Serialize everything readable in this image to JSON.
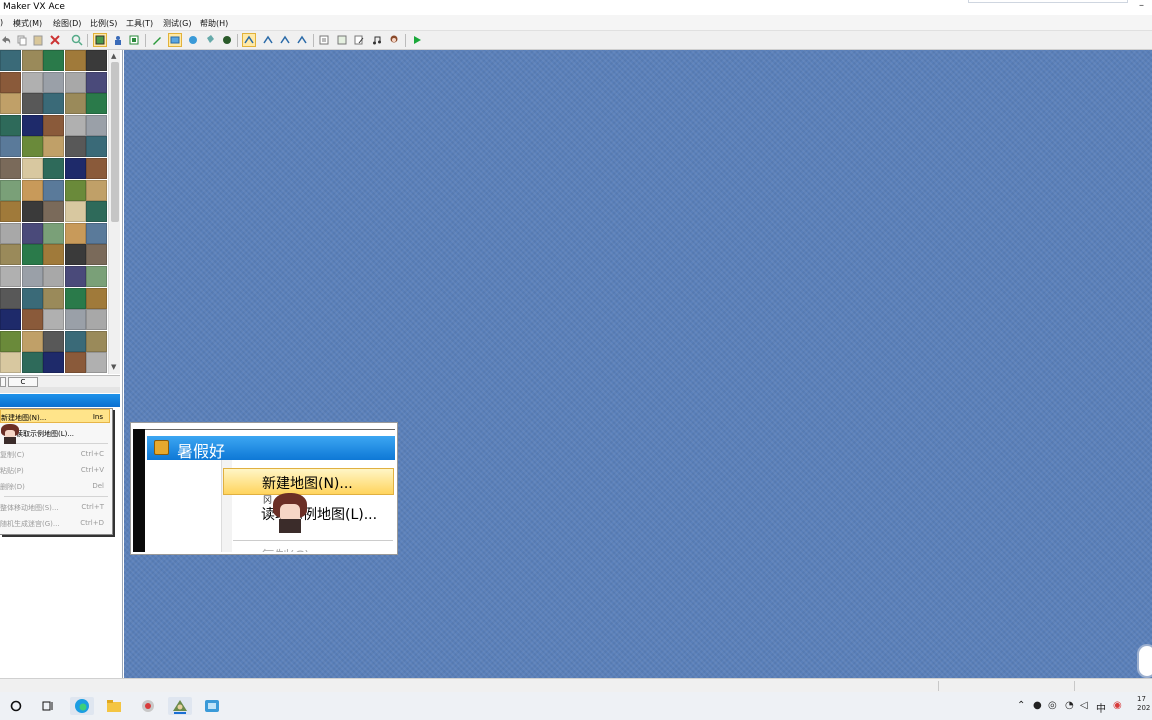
{
  "window": {
    "title": "Maker VX Ace",
    "minimize_glyph": "–"
  },
  "menubar": [
    {
      "id": "edit",
      "label": ")"
    },
    {
      "id": "mode",
      "label": "模式(M)"
    },
    {
      "id": "draw",
      "label": "绘图(D)"
    },
    {
      "id": "scale",
      "label": "比例(S)"
    },
    {
      "id": "tools",
      "label": "工具(T)"
    },
    {
      "id": "test",
      "label": "测试(G)"
    },
    {
      "id": "help",
      "label": "帮助(H)"
    }
  ],
  "toolbar": {
    "icons": [
      "undo-icon",
      "copy-icon",
      "paste-icon",
      "delete-icon",
      "search-icon",
      "layer-map-icon",
      "layer-event-icon",
      "pass-icon",
      "pencil-icon",
      "rectangle-icon",
      "ellipse-icon",
      "flood-fill-icon",
      "shadow-pen-icon",
      "zoom-1-1-icon",
      "zoom-1-2-icon",
      "zoom-1-4-icon",
      "zoom-1-8-icon",
      "database-icon",
      "resource-manager-icon",
      "script-editor-icon",
      "sound-test-icon",
      "character-generator-icon",
      "playtest-icon"
    ],
    "colors": {
      "accent_play": "#1aa83a",
      "selected": "#ffe9a6"
    }
  },
  "tileset_tabs": [
    "",
    "C"
  ],
  "context_menu": {
    "items": [
      {
        "label": "新建地图(N)...",
        "shortcut": "Ins",
        "highlighted": true,
        "disabled": false
      },
      {
        "label": "读取示例地图(L)...",
        "shortcut": "",
        "highlighted": false,
        "disabled": false
      },
      {
        "label": "复制(C)",
        "shortcut": "Ctrl+C",
        "highlighted": false,
        "disabled": true
      },
      {
        "label": "粘贴(P)",
        "shortcut": "Ctrl+V",
        "highlighted": false,
        "disabled": true
      },
      {
        "label": "删除(D)",
        "shortcut": "Del",
        "highlighted": false,
        "disabled": true
      },
      {
        "label": "整体移动地图(S)...",
        "shortcut": "Ctrl+T",
        "highlighted": false,
        "disabled": true
      },
      {
        "label": "随机生成迷宫(G)...",
        "shortcut": "Ctrl+D",
        "highlighted": false,
        "disabled": true
      }
    ]
  },
  "zoom_overlay": {
    "project_name": "暑假好",
    "items": [
      {
        "label": "新建地图(N)...",
        "highlighted": true
      },
      {
        "label": "读取示例地图(L)...",
        "highlighted": false
      },
      {
        "label": "复制(C)",
        "highlighted": false,
        "disabled": true
      }
    ],
    "small_glyph": "冈"
  },
  "taskbar": {
    "apps": [
      "search-icon",
      "task-view-icon",
      "edge-icon",
      "file-explorer-icon",
      "app-red-icon",
      "rpg-maker-icon",
      "app-blue-icon"
    ],
    "tray": [
      "chevron-up-icon",
      "microphone-icon",
      "network-icon",
      "wifi-icon",
      "speaker-icon",
      "ime-icon",
      "app-tray-icon"
    ],
    "ime_label": "中",
    "clock_line1": "17",
    "clock_line2": "202"
  },
  "colors": {
    "map_bg": "#5a80ba",
    "header_blue": "#0e78d6",
    "highlight": "#ffe48a"
  }
}
